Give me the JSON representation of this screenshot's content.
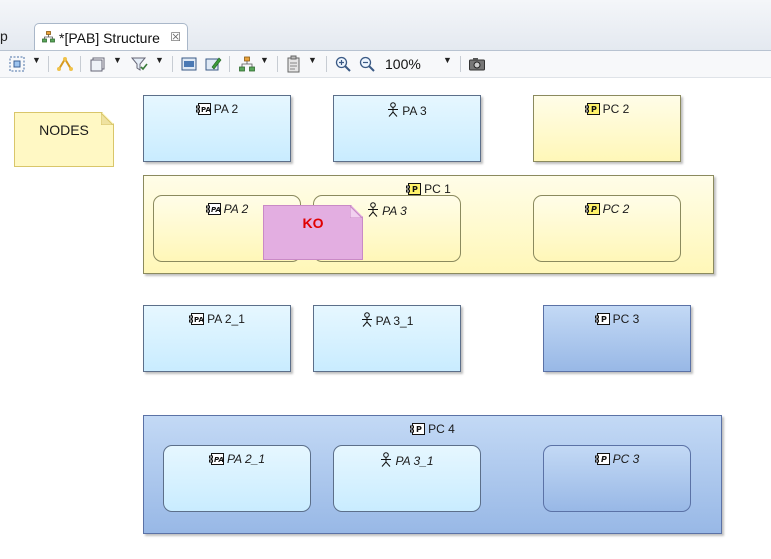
{
  "tabs": {
    "previous_fragment": "p",
    "active_title": "*[PAB] Structure",
    "close_glyph": "☒"
  },
  "toolbar": {
    "zoom_value": "100%",
    "buttons": [
      "select-all-icon",
      "arrange-icon",
      "layer-icon",
      "filter-icon",
      "refresh-icon",
      "edit-icon",
      "layout-icon",
      "paste-format-icon",
      "zoom-in-icon",
      "zoom-out-icon",
      "camera-icon"
    ]
  },
  "notes": {
    "nodes": "NODES",
    "ko": "KO"
  },
  "nodes": {
    "pa2_top": "PA 2",
    "pa3_top": "PA 3",
    "pc2_top": "PC 2",
    "pc1": "PC 1",
    "pc1_pa2": "PA 2",
    "pc1_pa3": "PA 3",
    "pc1_pc2": "PC 2",
    "pa2_1": "PA 2_1",
    "pa3_1": "PA 3_1",
    "pc3": "PC 3",
    "pc4": "PC 4",
    "pc4_pa2_1": "PA 2_1",
    "pc4_pa3_1": "PA 3_1",
    "pc4_pc3": "PC 3"
  },
  "colors": {
    "physical_actor_fill": "#d4f0ff",
    "node_component_yellow": "#fff9c4",
    "node_component_blue": "#a9c4ec",
    "note_yellow": "#fff8c4",
    "note_ko": "#e3aee1",
    "ko_text": "#e00000"
  }
}
